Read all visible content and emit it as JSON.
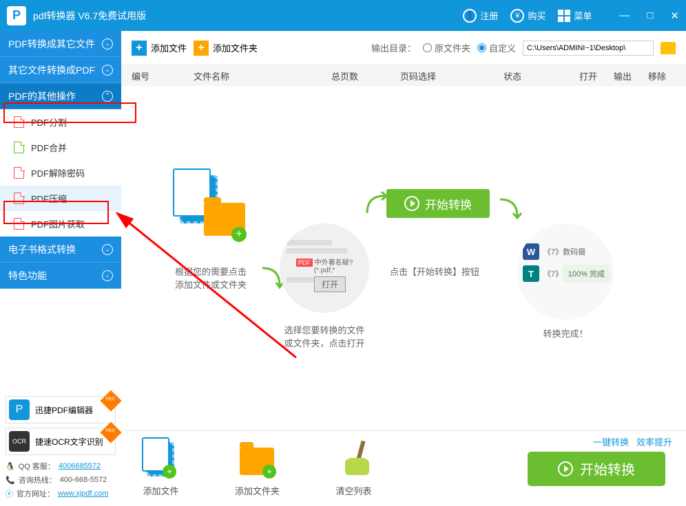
{
  "titlebar": {
    "app_title": "pdf转换器 V6.7免费试用版",
    "register": "注册",
    "buy": "购买",
    "menu": "菜单"
  },
  "sidebar": {
    "cats": [
      {
        "label": "PDF转换成其它文件",
        "expanded": false
      },
      {
        "label": "其它文件转换成PDF",
        "expanded": false
      },
      {
        "label": "PDF的其他操作",
        "expanded": true
      },
      {
        "label": "电子书格式转换",
        "expanded": false
      },
      {
        "label": "特色功能",
        "expanded": false
      }
    ],
    "items": [
      {
        "label": "PDF分割",
        "color": "red"
      },
      {
        "label": "PDF合并",
        "color": "green"
      },
      {
        "label": "PDF解除密码",
        "color": "red"
      },
      {
        "label": "PDF压缩",
        "color": "red",
        "active": true
      },
      {
        "label": "PDF图片获取",
        "color": "red"
      }
    ],
    "promos": [
      {
        "label": "迅捷PDF编辑器",
        "bg": "#1296db",
        "txt": "P"
      },
      {
        "label": "捷速OCR文字识别",
        "bg": "#333",
        "txt": "OCR"
      }
    ],
    "contacts": {
      "qq_label": "QQ 客服：",
      "qq": "4006685572",
      "tel_label": "咨询热线：",
      "tel": "400-668-5572",
      "site_label": "官方网址：",
      "site": "www.xjpdf.com"
    }
  },
  "toolbar": {
    "add_file": "添加文件",
    "add_folder": "添加文件夹",
    "output_label": "输出目录：",
    "radio_orig": "原文件夹",
    "radio_custom": "自定义",
    "path": "C:\\Users\\ADMINI~1\\Desktop\\"
  },
  "thead": {
    "num": "编号",
    "name": "文件名称",
    "pages": "总页数",
    "sel": "页码选择",
    "status": "状态",
    "open": "打开",
    "out": "输出",
    "del": "移除"
  },
  "steps": {
    "s1a": "根据您的需要点击",
    "s1b": "添加文件或文件夹",
    "s2_pdf": "中外著名疑?(*.pdf;*",
    "s2_open": "打开",
    "s2a": "选择您要转换的文件",
    "s2b": "或文件夹，点击打开",
    "s3_btn": "开始转换",
    "s3a": "点击【开始转换】按钮",
    "s4_r1": "《7》数码摄",
    "s4_r2": "《7》",
    "s4_done_pct": "100%",
    "s4_done_txt": "完成",
    "s4a": "转换完成！"
  },
  "bottom": {
    "promo1": "一键转换",
    "promo2": "效率提升",
    "add_file": "添加文件",
    "add_folder": "添加文件夹",
    "clear": "清空列表",
    "start": "开始转换"
  }
}
